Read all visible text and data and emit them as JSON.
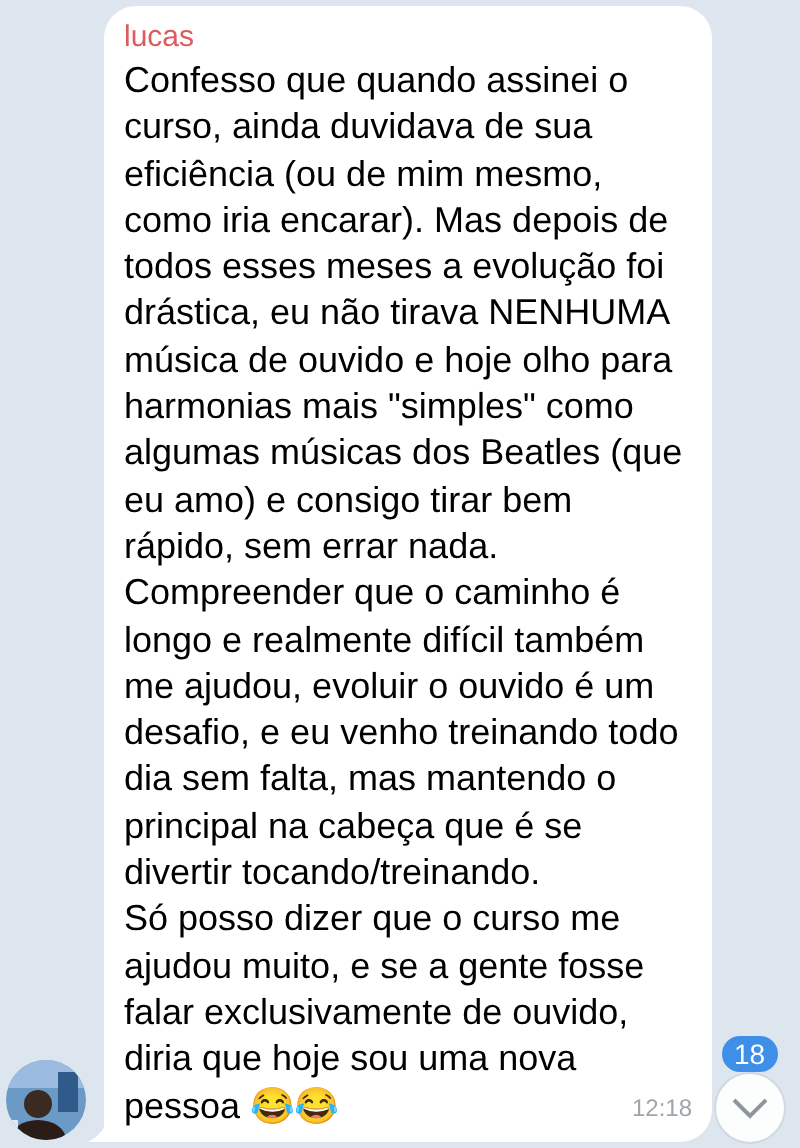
{
  "message": {
    "sender": "lucas",
    "paragraphs": [
      [
        "Confesso que quando assinei o",
        "curso, ainda duvidava de sua",
        "eficiência (ou de mim mesmo,",
        "como iria encarar). Mas depois de",
        "todos esses meses a evolução foi",
        "drástica, eu não tirava NENHUMA",
        "música de ouvido e hoje olho para",
        "harmonias mais \"simples\" como",
        "algumas músicas dos Beatles (que",
        "eu amo) e consigo tirar bem",
        "rápido, sem errar nada."
      ],
      [
        "Compreender que o caminho é",
        "longo e realmente difícil também",
        "me ajudou, evoluir o ouvido é um",
        "desafio, e eu venho treinando todo",
        "dia sem falta, mas mantendo o",
        "principal na cabeça que é se",
        "divertir tocando/treinando."
      ],
      [
        "Só posso dizer que o curso me",
        "ajudou muito, e se a gente fosse",
        "falar exclusivamente de ouvido,",
        "diria que hoje sou uma nova",
        "pessoa 😂😂"
      ]
    ],
    "time": "12:18"
  },
  "scroll_button": {
    "unread_count": "18"
  }
}
